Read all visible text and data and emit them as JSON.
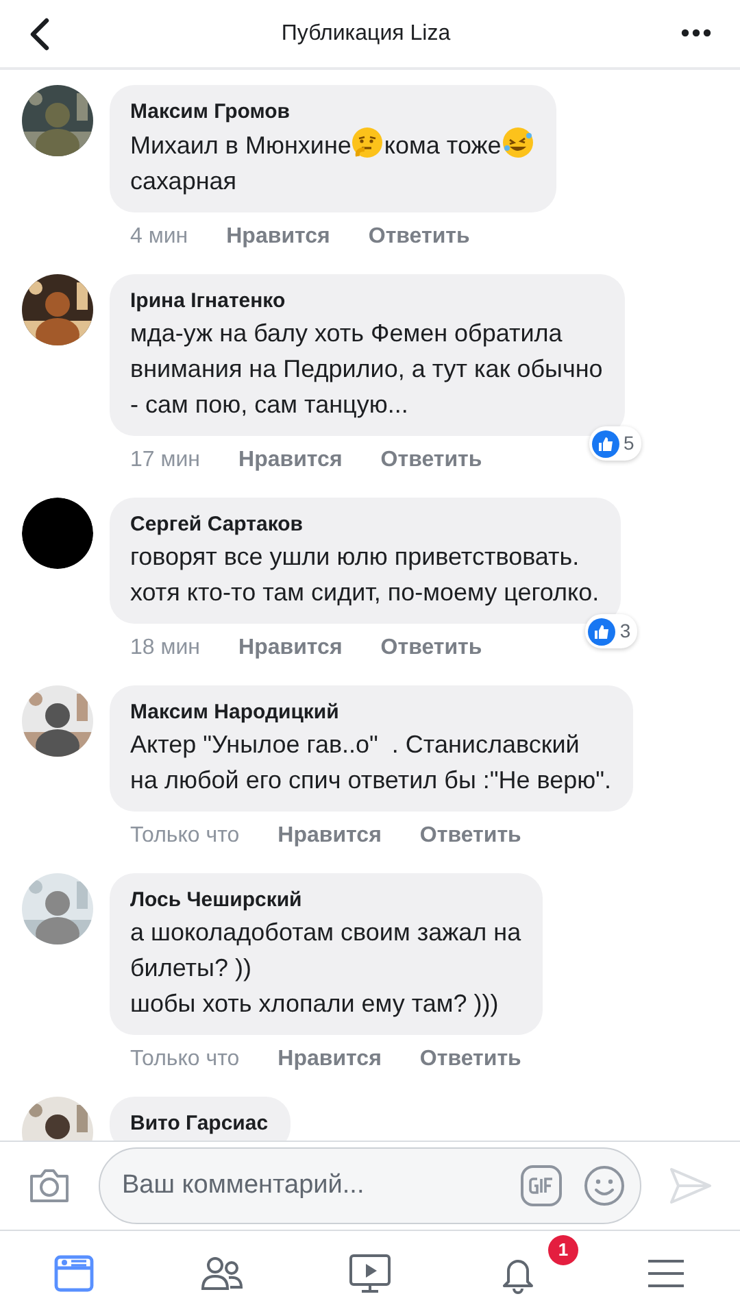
{
  "header": {
    "title": "Публикация Liza"
  },
  "comments": [
    {
      "avatar": {
        "kind": "picture"
      },
      "author": "Максим Громов",
      "body": [
        {
          "kind": "text",
          "text": "Михаил в Мюнхине"
        },
        {
          "kind": "thinking-emoji"
        },
        {
          "kind": "text",
          "text": "кома тоже"
        },
        {
          "kind": "laughing-emoji"
        },
        {
          "kind": "break"
        },
        {
          "kind": "text",
          "text": "сахарная"
        }
      ],
      "time": "4 мин",
      "like": "Нравится",
      "reply": "Ответить"
    },
    {
      "avatar": {
        "kind": "picture"
      },
      "author": "Ірина Ігнатенко",
      "body": [
        {
          "kind": "text",
          "text": "мда-уж на балу хоть Фемен обратила"
        },
        {
          "kind": "break"
        },
        {
          "kind": "text",
          "text": "внимания на Педрилио, а тут как обычно"
        },
        {
          "kind": "break"
        },
        {
          "kind": "text",
          "text": "- сам пою, сам танцую..."
        }
      ],
      "time": "17 мин",
      "like": "Нравится",
      "reply": "Ответить",
      "reactions": "5"
    },
    {
      "avatar": {
        "kind": "circle"
      },
      "author": "Сергей Сартаков",
      "body": [
        {
          "kind": "text",
          "text": "говорят все ушли юлю приветствовать."
        },
        {
          "kind": "break"
        },
        {
          "kind": "text",
          "text": "хотя кто-то там сидит, по-моему цеголко."
        }
      ],
      "time": "18 мин",
      "like": "Нравится",
      "reply": "Ответить",
      "reactions": "3"
    },
    {
      "avatar": {
        "kind": "picture"
      },
      "author": "Максим Народицкий",
      "body": [
        {
          "kind": "text",
          "text": "Актер \"Унылое гав..о\"  . Станиславский"
        },
        {
          "kind": "break"
        },
        {
          "kind": "text",
          "text": "на любой его спич ответил бы :\"Не верю\"."
        }
      ],
      "time": "Только что",
      "like": "Нравится",
      "reply": "Ответить"
    },
    {
      "avatar": {
        "kind": "picture"
      },
      "author": "Лось Чеширский",
      "body": [
        {
          "kind": "text",
          "text": "а шоколадоботам своим зажал на"
        },
        {
          "kind": "break"
        },
        {
          "kind": "text",
          "text": "билеты? ))"
        },
        {
          "kind": "break"
        },
        {
          "kind": "text",
          "text": "шобы хоть хлопали ему там? )))"
        }
      ],
      "time": "Только что",
      "like": "Нравится",
      "reply": "Ответить"
    },
    {
      "avatar": {
        "kind": "picture"
      },
      "author": "Вито Гарсиас"
    }
  ],
  "composer": {
    "placeholder": "Ваш комментарий..."
  },
  "tabs": [
    {
      "kind": "feed",
      "selected": true
    },
    {
      "kind": "friends",
      "selected": false
    },
    {
      "kind": "watch",
      "selected": false
    },
    {
      "kind": "notifications",
      "selected": false,
      "badge": "1"
    },
    {
      "kind": "menu",
      "selected": false
    }
  ]
}
